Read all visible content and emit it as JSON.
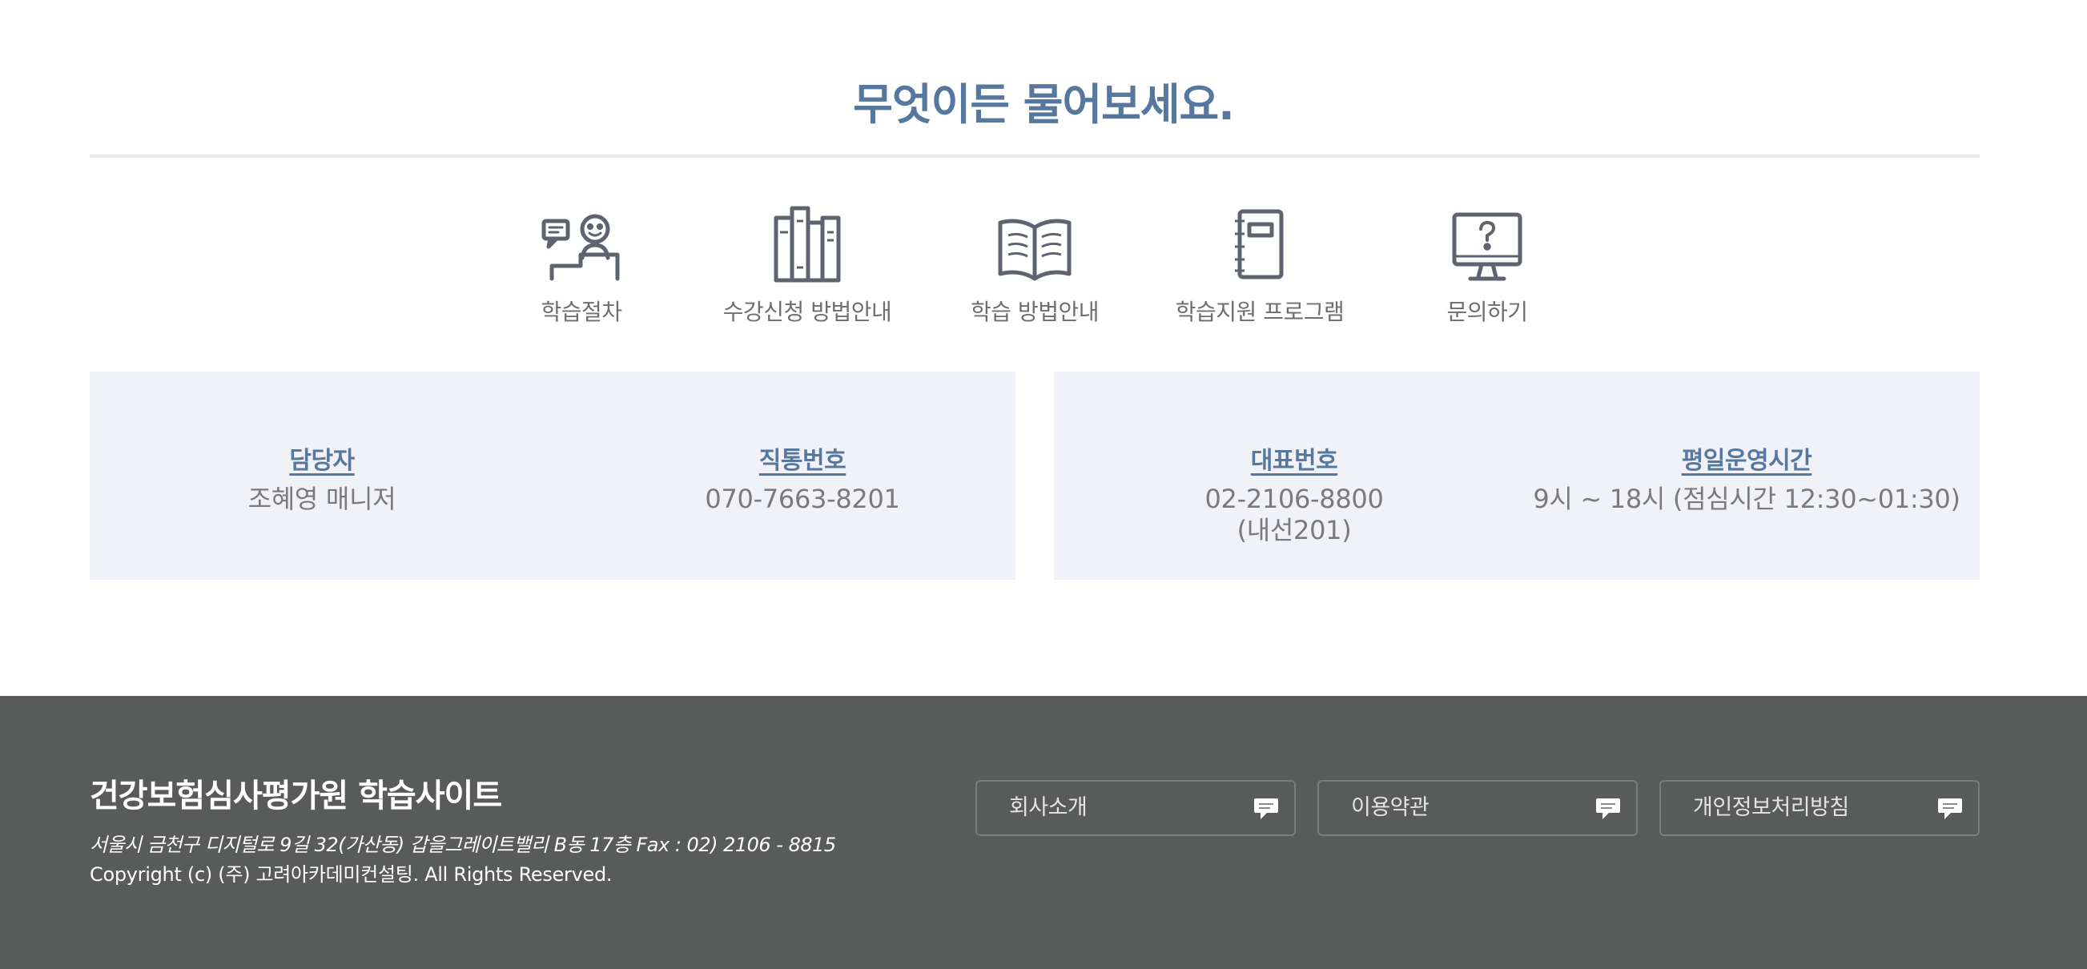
{
  "heading": "무엇이든 물어보세요.",
  "menu": [
    {
      "label": "학습절차",
      "icon": "consultation-icon"
    },
    {
      "label": "수강신청 방법안내",
      "icon": "books-icon"
    },
    {
      "label": "학습 방법안내",
      "icon": "open-book-icon"
    },
    {
      "label": "학습지원 프로그램",
      "icon": "notebook-icon"
    },
    {
      "label": "문의하기",
      "icon": "monitor-question-icon"
    }
  ],
  "contact": {
    "manager_label": "담당자",
    "manager_value": "조혜영 매니저",
    "direct_label": "직통번호",
    "direct_value": "070-7663-8201",
    "main_label": "대표번호",
    "main_value_line1": "02-2106-8800",
    "main_value_line2": "(내선201)",
    "hours_label": "평일운영시간",
    "hours_value": "9시 ~ 18시 (점심시간 12:30~01:30)"
  },
  "footer": {
    "site_title": "건강보험심사평가원 학습사이트",
    "address": "서울시 금천구 디지털로 9길 32(가산동) 갑을그레이트밸리 B동 17층   Fax : 02) 2106 - 8815",
    "copyright": "Copyright (c) (주) 고려아카데미컨설팅. All Rights Reserved.",
    "links": [
      {
        "label": "회사소개",
        "icon": "speech-bubble-icon"
      },
      {
        "label": "이용약관",
        "icon": "speech-bubble-icon"
      },
      {
        "label": "개인정보처리방침",
        "icon": "speech-bubble-icon"
      }
    ]
  },
  "colors": {
    "accent": "#56779e",
    "icon": "#5f6370",
    "panel_bg": "#f1f2f7",
    "footer_bg": "#595a5a"
  }
}
